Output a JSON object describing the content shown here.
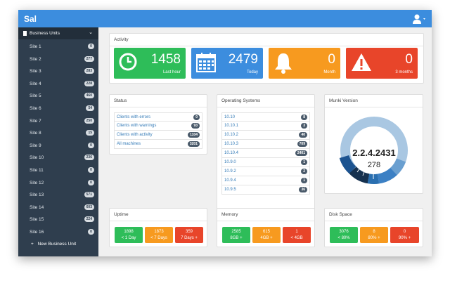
{
  "app": {
    "title": "Sal"
  },
  "sidebar": {
    "section_label": "Business Units",
    "sites": [
      {
        "name": "Site 1",
        "count": "0"
      },
      {
        "name": "Site 2",
        "count": "277"
      },
      {
        "name": "Site 3",
        "count": "283"
      },
      {
        "name": "Site 4",
        "count": "228"
      },
      {
        "name": "Site 5",
        "count": "460"
      },
      {
        "name": "Site 6",
        "count": "54"
      },
      {
        "name": "Site 7",
        "count": "250"
      },
      {
        "name": "Site 8",
        "count": "15"
      },
      {
        "name": "Site 9",
        "count": "0"
      },
      {
        "name": "Site 10",
        "count": "236"
      },
      {
        "name": "Site 11",
        "count": "0"
      },
      {
        "name": "Site 12",
        "count": "0"
      },
      {
        "name": "Site 13",
        "count": "571"
      },
      {
        "name": "Site 14",
        "count": "603"
      },
      {
        "name": "Site 15",
        "count": "224"
      },
      {
        "name": "Site 16",
        "count": "0"
      }
    ],
    "new_unit_label": "New Business Unit"
  },
  "activity": {
    "title": "Activity",
    "tiles": [
      {
        "value": "1458",
        "label": "Last hour",
        "color": "#2ebd59",
        "icon": "clock-icon"
      },
      {
        "value": "2479",
        "label": "Today",
        "color": "#3c8dde",
        "icon": "calendar-icon"
      },
      {
        "value": "0",
        "label": "Month",
        "color": "#f79a1f",
        "icon": "bell-icon"
      },
      {
        "value": "0",
        "label": "3 months",
        "color": "#e8452a",
        "icon": "warning-icon"
      }
    ]
  },
  "status": {
    "title": "Status",
    "rows": [
      {
        "label": "Clients with errors",
        "count": "0"
      },
      {
        "label": "Clients with warnings",
        "count": "93"
      },
      {
        "label": "Clients with activity",
        "count": "1104"
      },
      {
        "label": "All machines",
        "count": "3201"
      }
    ]
  },
  "os": {
    "title": "Operating Systems",
    "rows": [
      {
        "label": "10.10",
        "count": "8"
      },
      {
        "label": "10.10.1",
        "count": "3"
      },
      {
        "label": "10.10.2",
        "count": "40"
      },
      {
        "label": "10.10.3",
        "count": "709"
      },
      {
        "label": "10.10.4",
        "count": "2401"
      },
      {
        "label": "10.9.0",
        "count": "1"
      },
      {
        "label": "10.9.2",
        "count": "2"
      },
      {
        "label": "10.9.4",
        "count": "1"
      },
      {
        "label": "10.9.5",
        "count": "36"
      }
    ]
  },
  "munki": {
    "title": "Munki Version",
    "version": "2.2.4.2431",
    "count": "278"
  },
  "uptime": {
    "title": "Uptime",
    "cells": [
      {
        "value": "1898",
        "label": "< 1 Day",
        "color": "#2ebd59"
      },
      {
        "value": "1873",
        "label": "< 7 Days",
        "color": "#f79a1f"
      },
      {
        "value": "359",
        "label": "7 Days +",
        "color": "#e8452a"
      }
    ]
  },
  "memory": {
    "title": "Memory",
    "cells": [
      {
        "value": "2585",
        "label": "8GB +",
        "color": "#2ebd59"
      },
      {
        "value": "615",
        "label": "4GB +",
        "color": "#f79a1f"
      },
      {
        "value": "1",
        "label": "< 4GB",
        "color": "#e8452a"
      }
    ]
  },
  "disk": {
    "title": "Disk Space",
    "cells": [
      {
        "value": "3076",
        "label": "< 80%",
        "color": "#2ebd59"
      },
      {
        "value": "8",
        "label": "80% +",
        "color": "#f79a1f"
      },
      {
        "value": "0",
        "label": "90% +",
        "color": "#e8452a"
      }
    ]
  }
}
